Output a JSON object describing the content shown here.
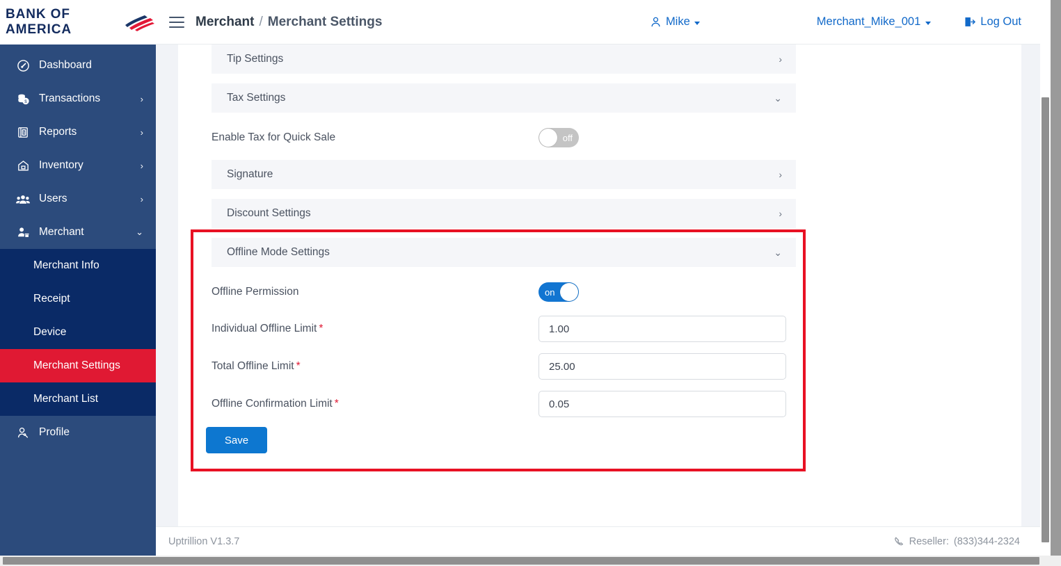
{
  "brand": {
    "name": "BANK OF AMERICA",
    "logo_icon": "bofa-flag-icon"
  },
  "header": {
    "menu_icon": "hamburger-menu-icon",
    "breadcrumb": {
      "parent": "Merchant",
      "separator": "/",
      "current": "Merchant Settings"
    },
    "user": {
      "icon": "user-icon",
      "label": "Mike",
      "caret_icon": "chevron-down-icon"
    },
    "merchant": {
      "label": "Merchant_Mike_001",
      "caret_icon": "chevron-down-icon"
    },
    "logout": {
      "icon": "logout-icon",
      "label": "Log Out"
    }
  },
  "sidebar": {
    "items": [
      {
        "label": "Dashboard",
        "icon": "dashboard-icon",
        "expandable": false,
        "chevron": ""
      },
      {
        "label": "Transactions",
        "icon": "transactions-icon",
        "expandable": true,
        "chevron": "›"
      },
      {
        "label": "Reports",
        "icon": "reports-icon",
        "expandable": true,
        "chevron": "›"
      },
      {
        "label": "Inventory",
        "icon": "inventory-icon",
        "expandable": true,
        "chevron": "›"
      },
      {
        "label": "Users",
        "icon": "users-icon",
        "expandable": true,
        "chevron": "›"
      },
      {
        "label": "Merchant",
        "icon": "merchant-icon",
        "expandable": true,
        "chevron": "⌄"
      }
    ],
    "submenu": [
      {
        "label": "Merchant Info",
        "active": false
      },
      {
        "label": "Receipt",
        "active": false
      },
      {
        "label": "Device",
        "active": false
      },
      {
        "label": "Merchant Settings",
        "active": true
      },
      {
        "label": "Merchant List",
        "active": false
      }
    ],
    "profile": {
      "label": "Profile",
      "icon": "profile-icon"
    },
    "active_color": "#e01933"
  },
  "main": {
    "sections": [
      {
        "title": "Tip Settings",
        "chevron": "›",
        "expanded": false
      },
      {
        "title": "Tax Settings",
        "chevron": "⌄",
        "expanded": true
      },
      {
        "title": "Signature",
        "chevron": "›",
        "expanded": false
      },
      {
        "title": "Discount Settings",
        "chevron": "›",
        "expanded": false
      },
      {
        "title": "Offline Mode Settings",
        "chevron": "⌄",
        "expanded": true
      }
    ],
    "tax": {
      "toggle_label": "Enable Tax for Quick Sale",
      "toggle_state": "off",
      "toggle_text": "off"
    },
    "offline": {
      "permission_label": "Offline Permission",
      "permission_state": "on",
      "permission_text": "on",
      "fields": [
        {
          "label": "Individual Offline Limit",
          "required": "*",
          "value": "1.00"
        },
        {
          "label": "Total Offline Limit",
          "required": "*",
          "value": "25.00"
        },
        {
          "label": "Offline Confirmation Limit",
          "required": "*",
          "value": "0.05"
        }
      ],
      "save_label": "Save"
    },
    "highlight_color": "#e81123"
  },
  "footer": {
    "version": "Uptrillion V1.3.7",
    "phone_icon": "phone-icon",
    "reseller_label": "Reseller:",
    "reseller_phone": "(833)344-2324"
  }
}
